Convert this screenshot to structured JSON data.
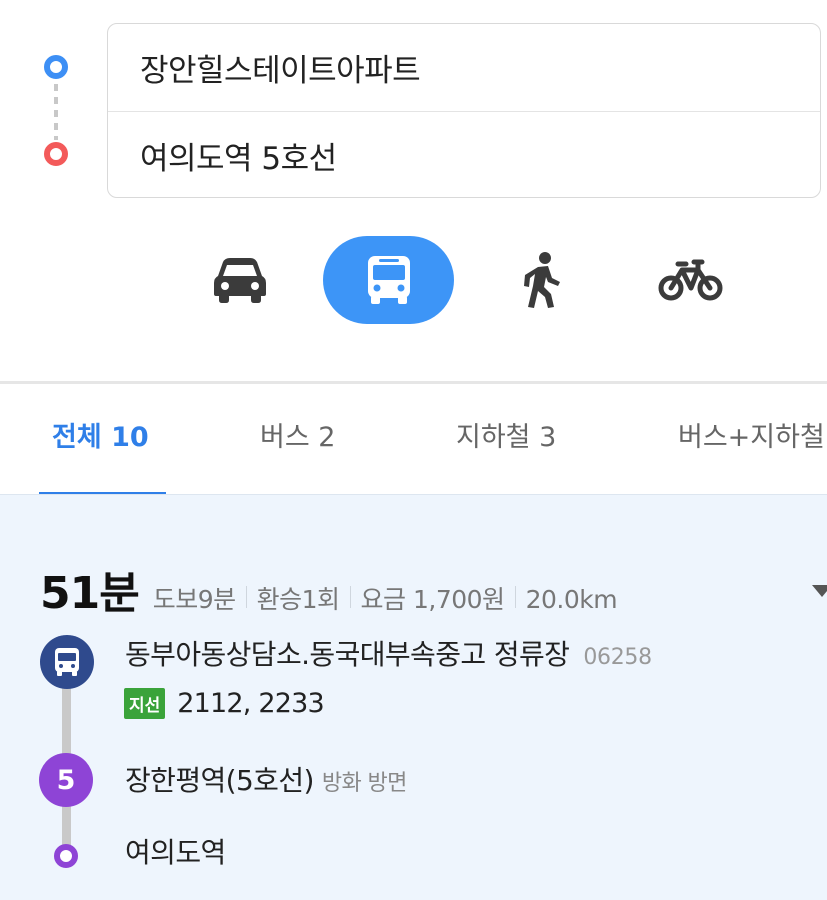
{
  "search": {
    "origin": "장안힐스테이트아파트",
    "destination": "여의도역 5호선"
  },
  "modes": [
    {
      "name": "car-icon",
      "selected": false
    },
    {
      "name": "bus-icon",
      "selected": true
    },
    {
      "name": "walk-icon",
      "selected": false
    },
    {
      "name": "bike-icon",
      "selected": false
    }
  ],
  "tabs": [
    {
      "label": "전체 10",
      "active": true
    },
    {
      "label": "버스 2",
      "active": false
    },
    {
      "label": "지하철 3",
      "active": false
    },
    {
      "label": "버스+지하철",
      "active": false
    }
  ],
  "route": {
    "total_time": "51분",
    "walk": "도보9분",
    "transfers": "환승1회",
    "fare": "요금 1,700원",
    "distance": "20.0km",
    "steps": [
      {
        "type": "bus-stop",
        "name": "동부아동상담소.동국대부속중고 정류장",
        "stop_id": "06258"
      },
      {
        "type": "bus-lines",
        "badge": "지선",
        "lines": "2112, 2233"
      },
      {
        "type": "subway",
        "line_label": "5",
        "name": "장한평역(5호선)",
        "direction": "방화 방면"
      },
      {
        "type": "destination",
        "name": "여의도역"
      }
    ]
  },
  "colors": {
    "accent_blue": "#3d95f7",
    "tab_active": "#2f7fe8",
    "origin_dot": "#3d8ff5",
    "destination_dot": "#f35a5a",
    "bus_node": "#2f4a8d",
    "subway_line5": "#8e44d6",
    "branch_bus_badge": "#3aa33a",
    "card_background": "#eef5fd"
  }
}
